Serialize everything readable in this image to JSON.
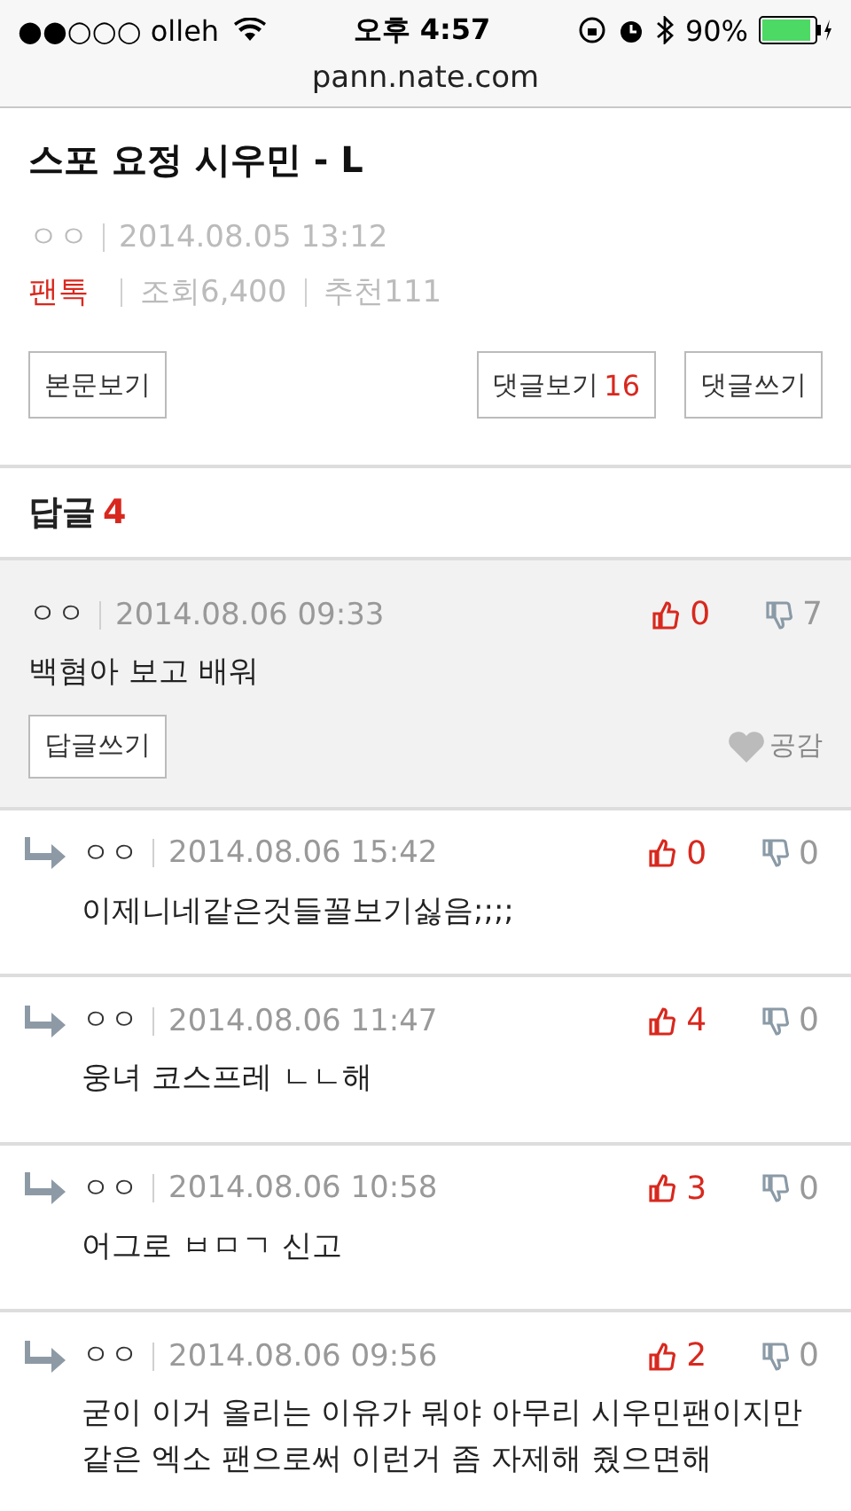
{
  "status_bar": {
    "carrier": "●●○○○ olleh",
    "time": "오후 4:57",
    "battery": "90%"
  },
  "url": "pann.nate.com",
  "post": {
    "title": "스포 요정 시우민 - L",
    "author": "ㅇㅇ",
    "date": "2014.08.05 13:12",
    "category": "팬톡",
    "views": "조회6,400",
    "recommend": "추천111"
  },
  "buttons": {
    "view_body": "본문보기",
    "view_comments": "댓글보기",
    "comment_count": "16",
    "write_comment": "댓글쓰기"
  },
  "replies_heading": {
    "label": "답글",
    "count": "4"
  },
  "comments": [
    {
      "kind": "comment",
      "author": "ㅇㅇ",
      "date": "2014.08.06 09:33",
      "up": "0",
      "down": "7",
      "text": "백혐아 보고 배워",
      "reply_button": "답글쓰기",
      "like": "공감"
    },
    {
      "kind": "reply",
      "author": "ㅇㅇ",
      "date": "2014.08.06 15:42",
      "up": "0",
      "down": "0",
      "text": "이제니네같은것들꼴보기싫음;;;;"
    },
    {
      "kind": "reply",
      "author": "ㅇㅇ",
      "date": "2014.08.06 11:47",
      "up": "4",
      "down": "0",
      "text": "웅녀 코스프레 ㄴㄴ해"
    },
    {
      "kind": "reply",
      "author": "ㅇㅇ",
      "date": "2014.08.06 10:58",
      "up": "3",
      "down": "0",
      "text": "어그로 ㅂㅁㄱ 신고"
    },
    {
      "kind": "reply",
      "author": "ㅇㅇ",
      "date": "2014.08.06 09:56",
      "up": "2",
      "down": "0",
      "text": "굳이 이거 올리는 이유가 뭐야 아무리 시우민팬이지만 같은 엑소 팬으로써 이런거 좀 자제해 줬으면해"
    }
  ]
}
